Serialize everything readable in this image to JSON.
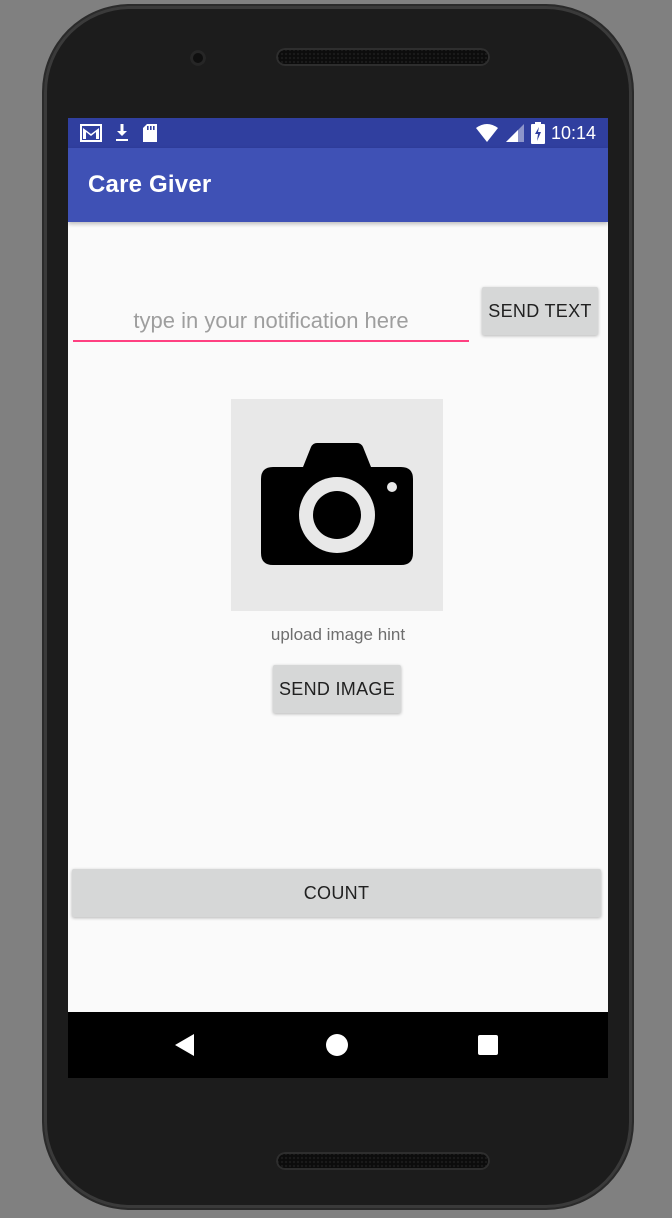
{
  "status_bar": {
    "time": "10:14",
    "icons": [
      "gmail-icon",
      "download-icon",
      "sd-card-icon",
      "wifi-icon",
      "signal-icon",
      "battery-charging-icon"
    ]
  },
  "app_bar": {
    "title": "Care Giver"
  },
  "notification": {
    "placeholder": "type in your notification here",
    "value": ""
  },
  "buttons": {
    "send_text": "SEND TEXT",
    "send_image": "SEND IMAGE",
    "count": "COUNT"
  },
  "image_upload": {
    "icon": "camera-icon",
    "hint": "upload image hint"
  },
  "nav_bar": {
    "icons": [
      "back-icon",
      "home-icon",
      "recents-icon"
    ]
  },
  "colors": {
    "status_bar": "#303f9f",
    "app_bar": "#3f51b5",
    "accent": "#ff4081",
    "button": "#d6d7d7",
    "background": "#fafafa"
  }
}
